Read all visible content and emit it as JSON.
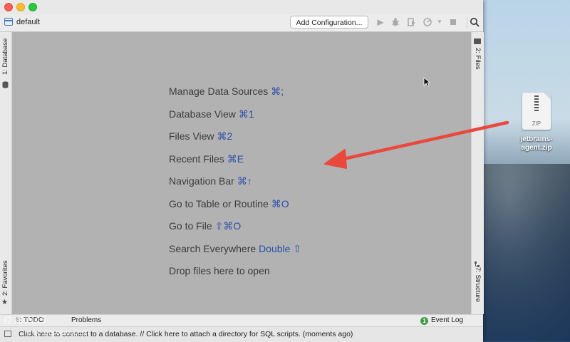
{
  "window": {
    "project": "default"
  },
  "toolbar": {
    "add_configuration": "Add Configuration..."
  },
  "left_stripe": {
    "top_tab": "1: Database",
    "bottom_tab": "2: Favorites"
  },
  "right_stripe": {
    "top_tab": "2: Files",
    "bottom_tab": "7: Structure"
  },
  "hints": [
    {
      "text": "Manage Data Sources ",
      "key": "⌘;"
    },
    {
      "text": "Database View ",
      "key": "⌘1"
    },
    {
      "text": "Files View ",
      "key": "⌘2"
    },
    {
      "text": "Recent Files ",
      "key": "⌘E"
    },
    {
      "text": "Navigation Bar ",
      "key": "⌘↑"
    },
    {
      "text": "Go to Table or Routine ",
      "key": "⌘O"
    },
    {
      "text": "Go to File ",
      "key": "⇧⌘O"
    },
    {
      "text": "Search Everywhere ",
      "key": "Double ⇧"
    },
    {
      "text": "Drop files here to open",
      "key": ""
    }
  ],
  "bottom_tools": {
    "todo": "6: TODO",
    "problems": "Problems",
    "event_log": "Event Log",
    "event_count": "1"
  },
  "status": {
    "message": "Click here to connect to a database. // Click here to attach a directory for SQL scripts. (moments ago)"
  },
  "desktop_file": {
    "name_line1": "jetbrains-",
    "name_line2": "agent.zip",
    "type": "ZIP"
  },
  "watermark": {
    "text": "Ω AXNAS · mac.orsoon.com"
  },
  "colors": {
    "accent_arrow": "#e8493c",
    "shortcut": "#2c4fa8",
    "editor_bg": "#b2b2b2"
  }
}
